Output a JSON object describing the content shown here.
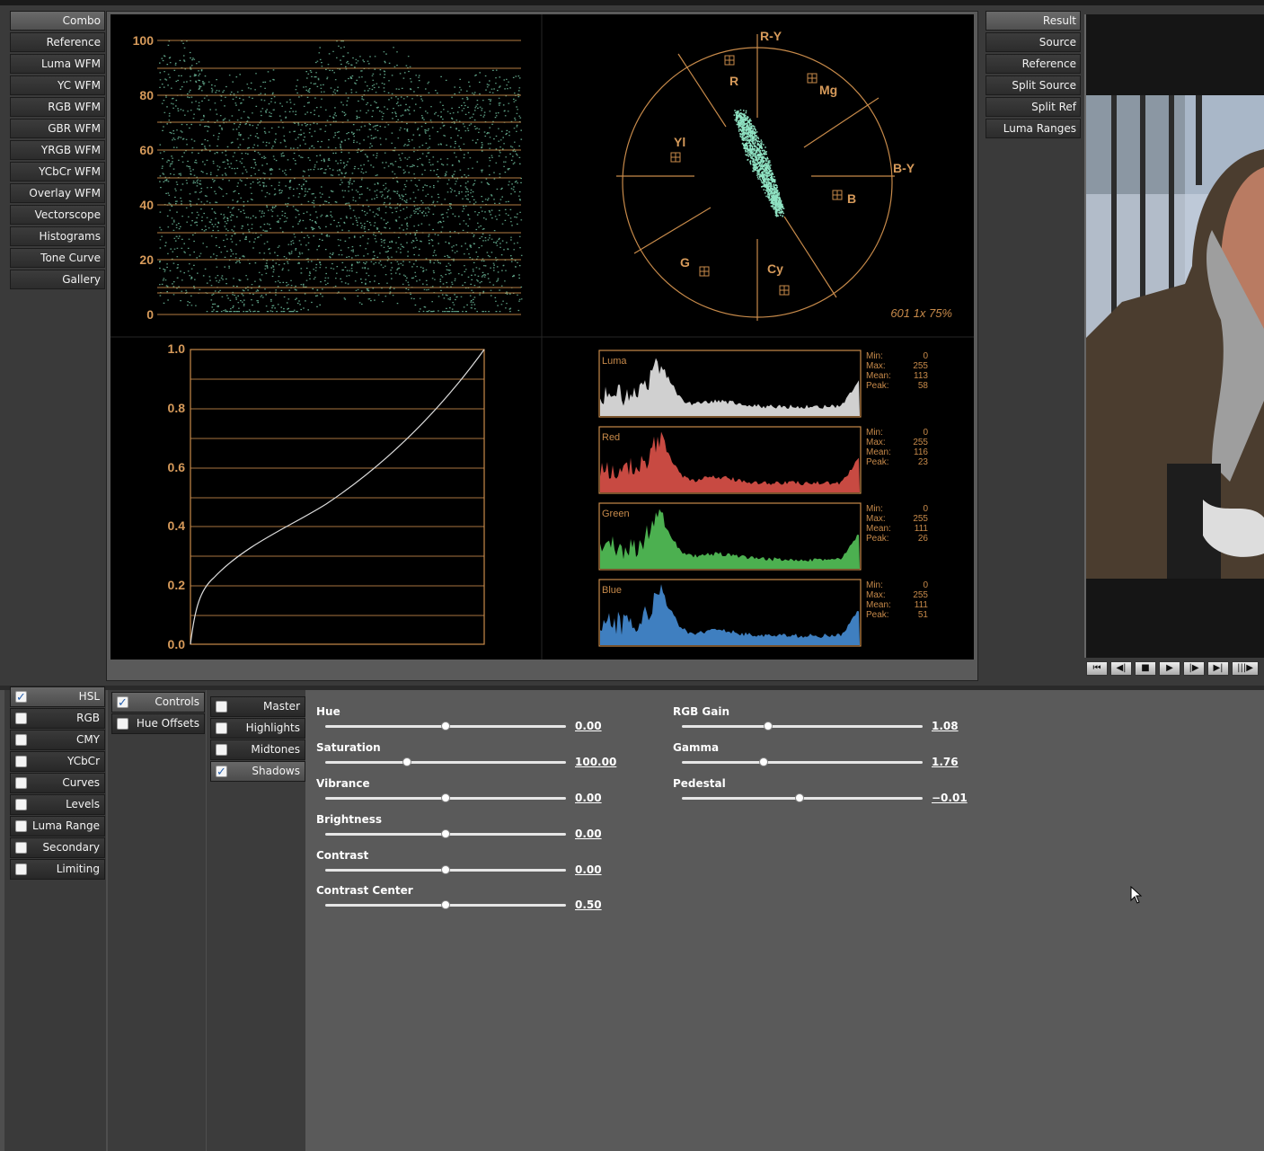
{
  "scope_tabs": [
    "Combo",
    "Reference",
    "Luma WFM",
    "YC WFM",
    "RGB WFM",
    "GBR WFM",
    "YRGB WFM",
    "YCbCr WFM",
    "Overlay WFM",
    "Vectorscope",
    "Histograms",
    "Tone Curve",
    "Gallery"
  ],
  "view_tabs": [
    "Result",
    "Source",
    "Reference",
    "Split Source",
    "Split Ref",
    "Luma Ranges"
  ],
  "waveform": {
    "ticks": [
      "100",
      "80",
      "60",
      "40",
      "20",
      "0"
    ]
  },
  "vectorscope": {
    "axis_labels": {
      "ry": "R-Y",
      "by": "B-Y"
    },
    "targets": {
      "r": "R",
      "mg": "Mg",
      "yl": "Yl",
      "b": "B",
      "g": "G",
      "cy": "Cy"
    },
    "readout": "601 1x 75%"
  },
  "tone_curve": {
    "ticks": [
      "1.0",
      "0.8",
      "0.6",
      "0.4",
      "0.2",
      "0.0"
    ]
  },
  "histograms": [
    {
      "name": "Luma",
      "color": "#d0d0d0",
      "stats": {
        "min": "0",
        "max": "255",
        "mean": "113",
        "peak": "58"
      }
    },
    {
      "name": "Red",
      "color": "#c84a42",
      "stats": {
        "min": "0",
        "max": "255",
        "mean": "116",
        "peak": "23"
      }
    },
    {
      "name": "Green",
      "color": "#4cb050",
      "stats": {
        "min": "0",
        "max": "255",
        "mean": "111",
        "peak": "26"
      }
    },
    {
      "name": "Blue",
      "color": "#3f7fc0",
      "stats": {
        "min": "0",
        "max": "255",
        "mean": "111",
        "peak": "51"
      }
    }
  ],
  "stat_labels": {
    "min": "Min:",
    "max": "Max:",
    "mean": "Mean:",
    "peak": "Peak:"
  },
  "transport": [
    "⏮",
    "◀|",
    "■",
    "▶",
    "|▶",
    "▶|",
    "|||▶"
  ],
  "color_tabs": [
    {
      "label": "HSL",
      "checked": true
    },
    {
      "label": "RGB",
      "checked": false
    },
    {
      "label": "CMY",
      "checked": false
    },
    {
      "label": "YCbCr",
      "checked": false
    },
    {
      "label": "Curves",
      "checked": false
    },
    {
      "label": "Levels",
      "checked": false
    },
    {
      "label": "Luma Range",
      "checked": false
    },
    {
      "label": "Secondary",
      "checked": false
    },
    {
      "label": "Limiting",
      "checked": false
    }
  ],
  "sub_tabs": [
    {
      "label": "Controls",
      "checked": true
    },
    {
      "label": "Hue Offsets",
      "checked": false
    }
  ],
  "range_tabs": [
    {
      "label": "Master",
      "checked": false
    },
    {
      "label": "Highlights",
      "checked": false
    },
    {
      "label": "Midtones",
      "checked": false
    },
    {
      "label": "Shadows",
      "checked": true
    }
  ],
  "sliders_left": [
    {
      "label": "Hue",
      "value": "0.00",
      "pos": 0.5
    },
    {
      "label": "Saturation",
      "value": "100.00",
      "pos": 0.34
    },
    {
      "label": "Vibrance",
      "value": "0.00",
      "pos": 0.5
    },
    {
      "label": "Brightness",
      "value": "0.00",
      "pos": 0.5
    },
    {
      "label": "Contrast",
      "value": "0.00",
      "pos": 0.5
    },
    {
      "label": "Contrast Center",
      "value": "0.50",
      "pos": 0.5
    }
  ],
  "sliders_right": [
    {
      "label": "RGB Gain",
      "value": "1.08",
      "pos": 0.36
    },
    {
      "label": "Gamma",
      "value": "1.76",
      "pos": 0.34
    },
    {
      "label": "Pedestal",
      "value": "−0.01",
      "pos": 0.49
    }
  ]
}
